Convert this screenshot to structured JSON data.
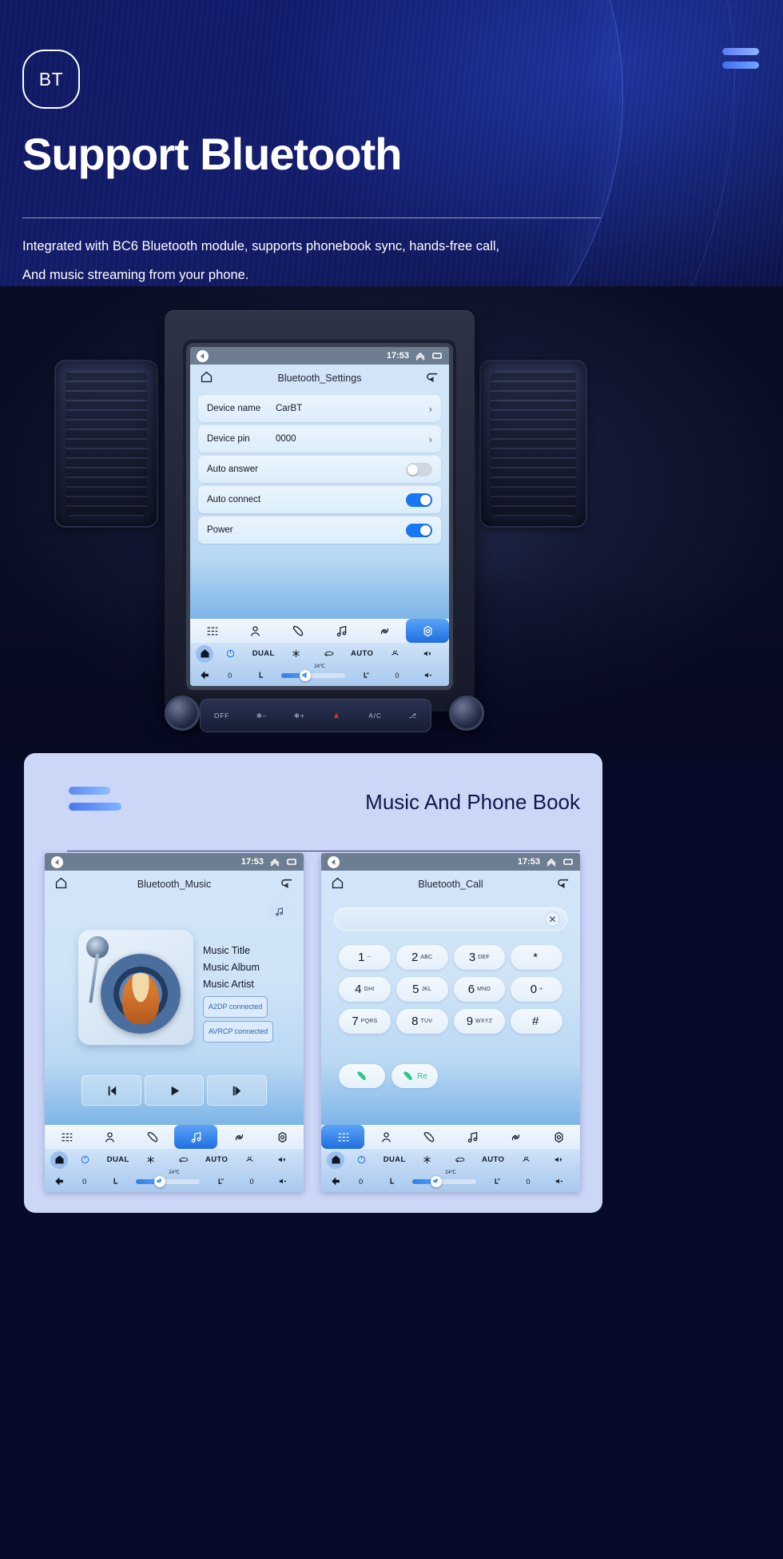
{
  "hero": {
    "badge": "BT",
    "title": "Support Bluetooth",
    "subtitle_line1": "Integrated with BC6 Bluetooth module, supports phonebook sync, hands-free call,",
    "subtitle_line2": "And music streaming from your phone.",
    "accent_color": "#5b7cf5",
    "background_color": "#0d1550"
  },
  "main_screen": {
    "statusbar": {
      "clock": "17:53",
      "back_icon": "back-arrow-icon",
      "collapse_icon": "chevron-up-icon",
      "recents_icon": "recents-icon"
    },
    "header": {
      "home_icon": "home-icon",
      "title": "Bluetooth_Settings",
      "return_icon": "return-arrow-icon"
    },
    "rows": [
      {
        "label": "Device name",
        "value": "CarBT",
        "control": "chevron",
        "chevron": "›"
      },
      {
        "label": "Device pin",
        "value": "0000",
        "control": "chevron",
        "chevron": "›"
      },
      {
        "label": "Auto answer",
        "value": "",
        "control": "toggle",
        "state": "off"
      },
      {
        "label": "Auto connect",
        "value": "",
        "control": "toggle",
        "state": "on"
      },
      {
        "label": "Power",
        "value": "",
        "control": "toggle",
        "state": "on"
      }
    ],
    "dock": [
      {
        "icon": "apps-grid-icon",
        "active": false
      },
      {
        "icon": "contact-person-icon",
        "active": false
      },
      {
        "icon": "phone-handset-icon",
        "active": false
      },
      {
        "icon": "music-note-icon",
        "active": false
      },
      {
        "icon": "link-chain-icon",
        "active": false
      },
      {
        "icon": "settings-gear-icon",
        "active": true
      }
    ],
    "climate": {
      "home_icon": "home-icon",
      "power_icon": "power-icon",
      "dual_label": "DUAL",
      "snow_icon": "snowflake-icon",
      "recirculate_icon": "air-recirculation-icon",
      "auto_label": "AUTO",
      "defrost_icon": "defrost-icon",
      "vol_up_icon": "volume-up-icon",
      "vol_down_icon": "volume-down-icon",
      "back_icon": "back-arrow-icon",
      "temperature": "24℃",
      "left_value": "0",
      "right_value": "0",
      "seat_icon": "seat-icon",
      "seat_heat_icon": "seat-heater-icon",
      "fan_icon": "fan-icon"
    }
  },
  "lower_card": {
    "title": "Music And Phone Book",
    "background_color": "#ccd6f7",
    "music_screen": {
      "statusbar": {
        "clock": "17:53"
      },
      "header": {
        "home_icon": "home-icon",
        "title": "Bluetooth_Music",
        "return_icon": "return-arrow-icon"
      },
      "badge_icon": "music-note-icon",
      "meta": {
        "title": "Music Title",
        "album": "Music Album",
        "artist": "Music Artist"
      },
      "status_pills": [
        "A2DP connected",
        "AVRCP connected"
      ],
      "controls": [
        {
          "icon": "previous-track-icon"
        },
        {
          "icon": "play-icon"
        },
        {
          "icon": "next-track-icon"
        }
      ],
      "dock": [
        {
          "icon": "apps-grid-icon",
          "active": false
        },
        {
          "icon": "contact-person-icon",
          "active": false
        },
        {
          "icon": "phone-handset-icon",
          "active": false
        },
        {
          "icon": "music-note-icon",
          "active": true
        },
        {
          "icon": "link-chain-icon",
          "active": false
        },
        {
          "icon": "settings-gear-icon",
          "active": false
        }
      ],
      "climate": {
        "dual_label": "DUAL",
        "auto_label": "AUTO",
        "temperature": "24℃",
        "left_value": "0",
        "right_value": "0"
      }
    },
    "call_screen": {
      "statusbar": {
        "clock": "17:53"
      },
      "header": {
        "home_icon": "home-icon",
        "title": "Bluetooth_Call",
        "return_icon": "return-arrow-icon"
      },
      "input": {
        "value": "",
        "clear_icon": "close-x-icon"
      },
      "keypad": [
        {
          "num": "1",
          "sub": "--"
        },
        {
          "num": "2",
          "sub": "ABC"
        },
        {
          "num": "3",
          "sub": "DEF"
        },
        {
          "num": "*",
          "sub": ""
        },
        {
          "num": "4",
          "sub": "GHI"
        },
        {
          "num": "5",
          "sub": "JKL"
        },
        {
          "num": "6",
          "sub": "MNO"
        },
        {
          "num": "0",
          "sub": "+"
        },
        {
          "num": "7",
          "sub": "PQRS"
        },
        {
          "num": "8",
          "sub": "TUV"
        },
        {
          "num": "9",
          "sub": "WXYZ"
        },
        {
          "num": "#",
          "sub": ""
        }
      ],
      "call_buttons": [
        {
          "icon": "phone-handset-icon",
          "label": ""
        },
        {
          "icon": "phone-handset-icon",
          "label": "Re"
        }
      ],
      "dock": [
        {
          "icon": "apps-grid-icon",
          "active": true
        },
        {
          "icon": "contact-person-icon",
          "active": false
        },
        {
          "icon": "phone-handset-icon",
          "active": false
        },
        {
          "icon": "music-note-icon",
          "active": false
        },
        {
          "icon": "link-chain-icon",
          "active": false
        },
        {
          "icon": "settings-gear-icon",
          "active": false
        }
      ],
      "climate": {
        "dual_label": "DUAL",
        "auto_label": "AUTO",
        "temperature": "24℃",
        "left_value": "0",
        "right_value": "0"
      }
    }
  },
  "dashboard": {
    "climate_strip": [
      "OFF",
      "✻–",
      "✻+",
      "▲",
      "A/C",
      "⎇"
    ]
  }
}
